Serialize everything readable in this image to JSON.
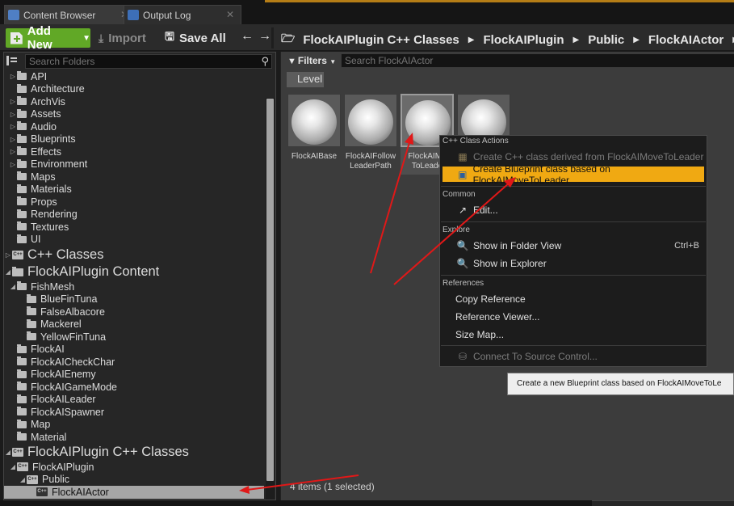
{
  "tabs": [
    {
      "label": "Content Browser",
      "icon": "content-browser-icon",
      "active": true
    },
    {
      "label": "Output Log",
      "icon": "output-log-icon",
      "active": false
    }
  ],
  "toolbar": {
    "add_new": "Add New",
    "import": "Import",
    "save_all": "Save All"
  },
  "breadcrumb": [
    "FlockAIPlugin C++ Classes",
    "FlockAIPlugin",
    "Public",
    "FlockAIActor"
  ],
  "folder_search": {
    "placeholder": "Search Folders"
  },
  "folders": [
    {
      "label": "API",
      "expandable": true
    },
    {
      "label": "Architecture",
      "expandable": false
    },
    {
      "label": "ArchVis",
      "expandable": true
    },
    {
      "label": "Assets",
      "expandable": true
    },
    {
      "label": "Audio",
      "expandable": true
    },
    {
      "label": "Blueprints",
      "expandable": true
    },
    {
      "label": "Effects",
      "expandable": true
    },
    {
      "label": "Environment",
      "expandable": true
    },
    {
      "label": "Maps",
      "expandable": false
    },
    {
      "label": "Materials",
      "expandable": false
    },
    {
      "label": "Props",
      "expandable": false
    },
    {
      "label": "Rendering",
      "expandable": false
    },
    {
      "label": "Textures",
      "expandable": false
    },
    {
      "label": "UI",
      "expandable": false
    },
    {
      "label": "C++ Classes",
      "expandable": true
    },
    {
      "label": "FlockAIPlugin Content",
      "expandable": true
    },
    {
      "label": "FishMesh",
      "expandable": true
    },
    {
      "label": "BlueFinTuna",
      "expandable": false
    },
    {
      "label": "FalseAlbacore",
      "expandable": false
    },
    {
      "label": "Mackerel",
      "expandable": false
    },
    {
      "label": "YellowFinTuna",
      "expandable": false
    },
    {
      "label": "FlockAI",
      "expandable": false
    },
    {
      "label": "FlockAICheckChar",
      "expandable": false
    },
    {
      "label": "FlockAIEnemy",
      "expandable": false
    },
    {
      "label": "FlockAIGameMode",
      "expandable": false
    },
    {
      "label": "FlockAILeader",
      "expandable": false
    },
    {
      "label": "FlockAISpawner",
      "expandable": false
    },
    {
      "label": "Map",
      "expandable": false
    },
    {
      "label": "Material",
      "expandable": false
    },
    {
      "label": "FlockAIPlugin C++ Classes",
      "expandable": true
    },
    {
      "label": "FlockAIPlugin",
      "expandable": true
    },
    {
      "label": "Public",
      "expandable": true
    },
    {
      "label": "FlockAIActor",
      "expandable": false,
      "selected": true
    }
  ],
  "content": {
    "filters_label": "Filters",
    "search_placeholder": "Search FlockAIActor",
    "filter_chip": "Level",
    "assets": [
      {
        "line1": "FlockAIBase",
        "line2": "",
        "selected": false
      },
      {
        "line1": "FlockAIFollow",
        "line2": "LeaderPath",
        "selected": false
      },
      {
        "line1": "FlockAIMo",
        "line2": "ToLeade",
        "selected": true
      },
      {
        "line1": "",
        "line2": "",
        "selected": false
      }
    ],
    "status": "4 items (1 selected)"
  },
  "context_menu": {
    "sections": {
      "class_actions": "C++ Class Actions",
      "common": "Common",
      "explore": "Explore",
      "references": "References"
    },
    "items": {
      "create_cpp": "Create C++ class derived from FlockAIMoveToLeader",
      "create_bp": "Create Blueprint class based on FlockAIMoveToLeader",
      "edit": "Edit...",
      "show_folder": "Show in Folder View",
      "show_folder_shortcut": "Ctrl+B",
      "show_explorer": "Show in Explorer",
      "copy_ref": "Copy Reference",
      "ref_viewer": "Reference Viewer...",
      "size_map": "Size Map...",
      "source_control": "Connect To Source Control..."
    }
  },
  "tooltip": "Create a new Blueprint class based on FlockAIMoveToLe",
  "colors": {
    "add_button": "#61a826",
    "highlight": "#f0a912",
    "annotation_arrow": "#e01818",
    "tab_accent": "#b57d16"
  }
}
